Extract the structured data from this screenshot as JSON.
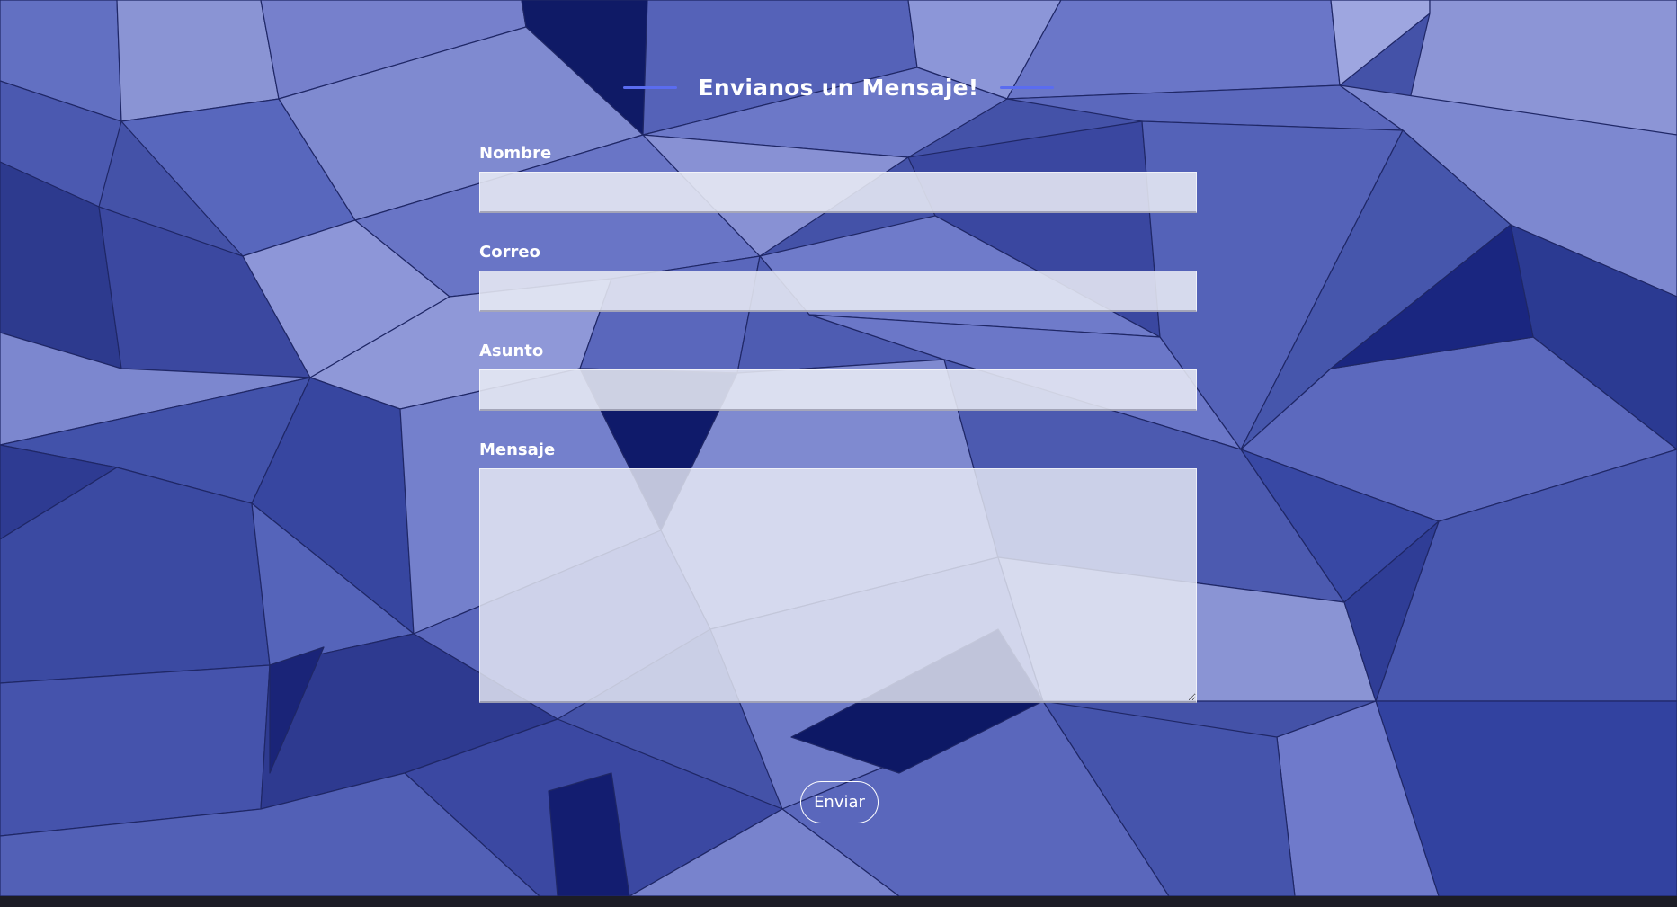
{
  "form": {
    "title": "Envianos un Mensaje!",
    "fields": [
      {
        "label": "Nombre",
        "value": "",
        "placeholder": ""
      },
      {
        "label": "Correo",
        "value": "",
        "placeholder": ""
      },
      {
        "label": "Asunto",
        "value": "",
        "placeholder": ""
      },
      {
        "label": "Mensaje",
        "value": "",
        "placeholder": ""
      }
    ],
    "submit_label": "Enviar"
  },
  "colors": {
    "background_base": "#3f4fa6",
    "title_accent_line": "#5a6cf0",
    "input_fill": "#e8eaf4",
    "text": "#ffffff",
    "bottom_bar": "#1c1d26"
  }
}
